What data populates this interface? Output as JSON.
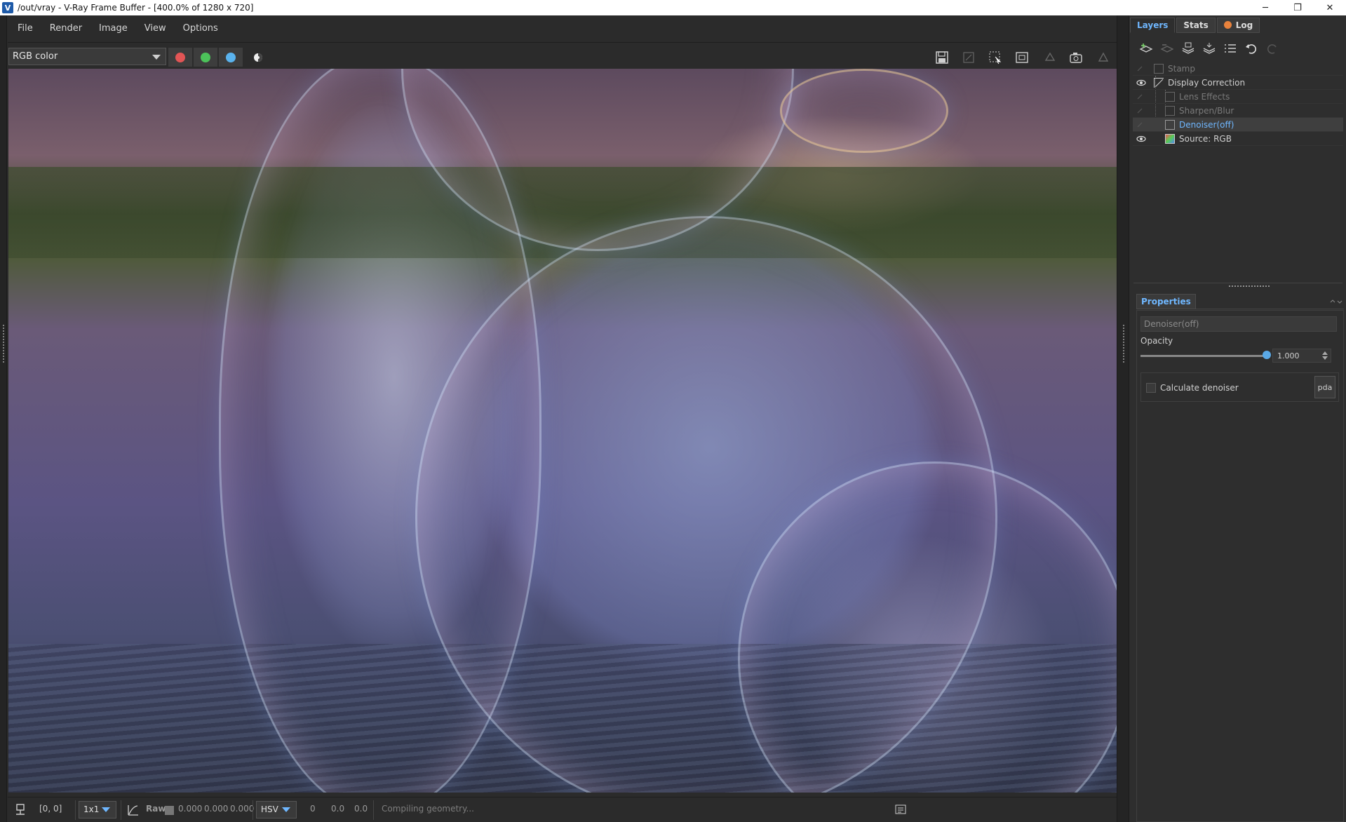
{
  "window": {
    "title": "/out/vray - V-Ray Frame Buffer - [400.0% of 1280 x 720]",
    "app_icon": "V",
    "controls": {
      "minimize": "─",
      "restore": "❐",
      "close": "✕"
    }
  },
  "menu": [
    "File",
    "Render",
    "Image",
    "View",
    "Options"
  ],
  "toolbar": {
    "channel": "RGB color",
    "channel_buttons": [
      {
        "name": "red-channel",
        "color": "#e25555"
      },
      {
        "name": "green-channel",
        "color": "#4cc25a"
      },
      {
        "name": "blue-channel",
        "color": "#5ab3ee"
      }
    ],
    "icons": [
      "save-icon",
      "clear-icon",
      "region-render-icon",
      "track-mouse-icon",
      "render-interactive-icon",
      "render-camera-icon",
      "stop-render-icon"
    ]
  },
  "status": {
    "coords": "[0, 0]",
    "sample_size": "1x1",
    "raw_label": "Raw",
    "rgb": [
      "0.000",
      "0.000",
      "0.000"
    ],
    "color_mode": "HSV",
    "hsv": [
      "0",
      "0.0",
      "0.0"
    ],
    "message": "Compiling geometry..."
  },
  "panel": {
    "tabs": [
      {
        "label": "Layers",
        "active": true
      },
      {
        "label": "Stats",
        "active": false
      },
      {
        "label": "Log",
        "active": false
      }
    ],
    "layers": [
      {
        "label": "Stamp",
        "visible": false,
        "indent": 0,
        "selected": false,
        "dim": true
      },
      {
        "label": "Display Correction",
        "visible": true,
        "indent": 0,
        "selected": false,
        "dim": false
      },
      {
        "label": "Lens Effects",
        "visible": false,
        "indent": 1,
        "selected": false,
        "dim": true
      },
      {
        "label": "Sharpen/Blur",
        "visible": false,
        "indent": 1,
        "selected": false,
        "dim": true
      },
      {
        "label": "Denoiser(off)",
        "visible": false,
        "indent": 1,
        "selected": true,
        "dim": false
      },
      {
        "label": "Source: RGB",
        "visible": true,
        "indent": 1,
        "selected": false,
        "dim": false
      }
    ],
    "properties": {
      "tab": "Properties",
      "layer_name": "Denoiser(off)",
      "opacity_label": "Opacity",
      "opacity_value": "1.000",
      "opacity_fraction": 1.0,
      "calculate_label": "Calculate denoiser",
      "update_label": "pda"
    }
  },
  "colors": {
    "accent": "#6fb7ff",
    "bg": "#2b2b2b",
    "panel": "#2e2e2e"
  }
}
